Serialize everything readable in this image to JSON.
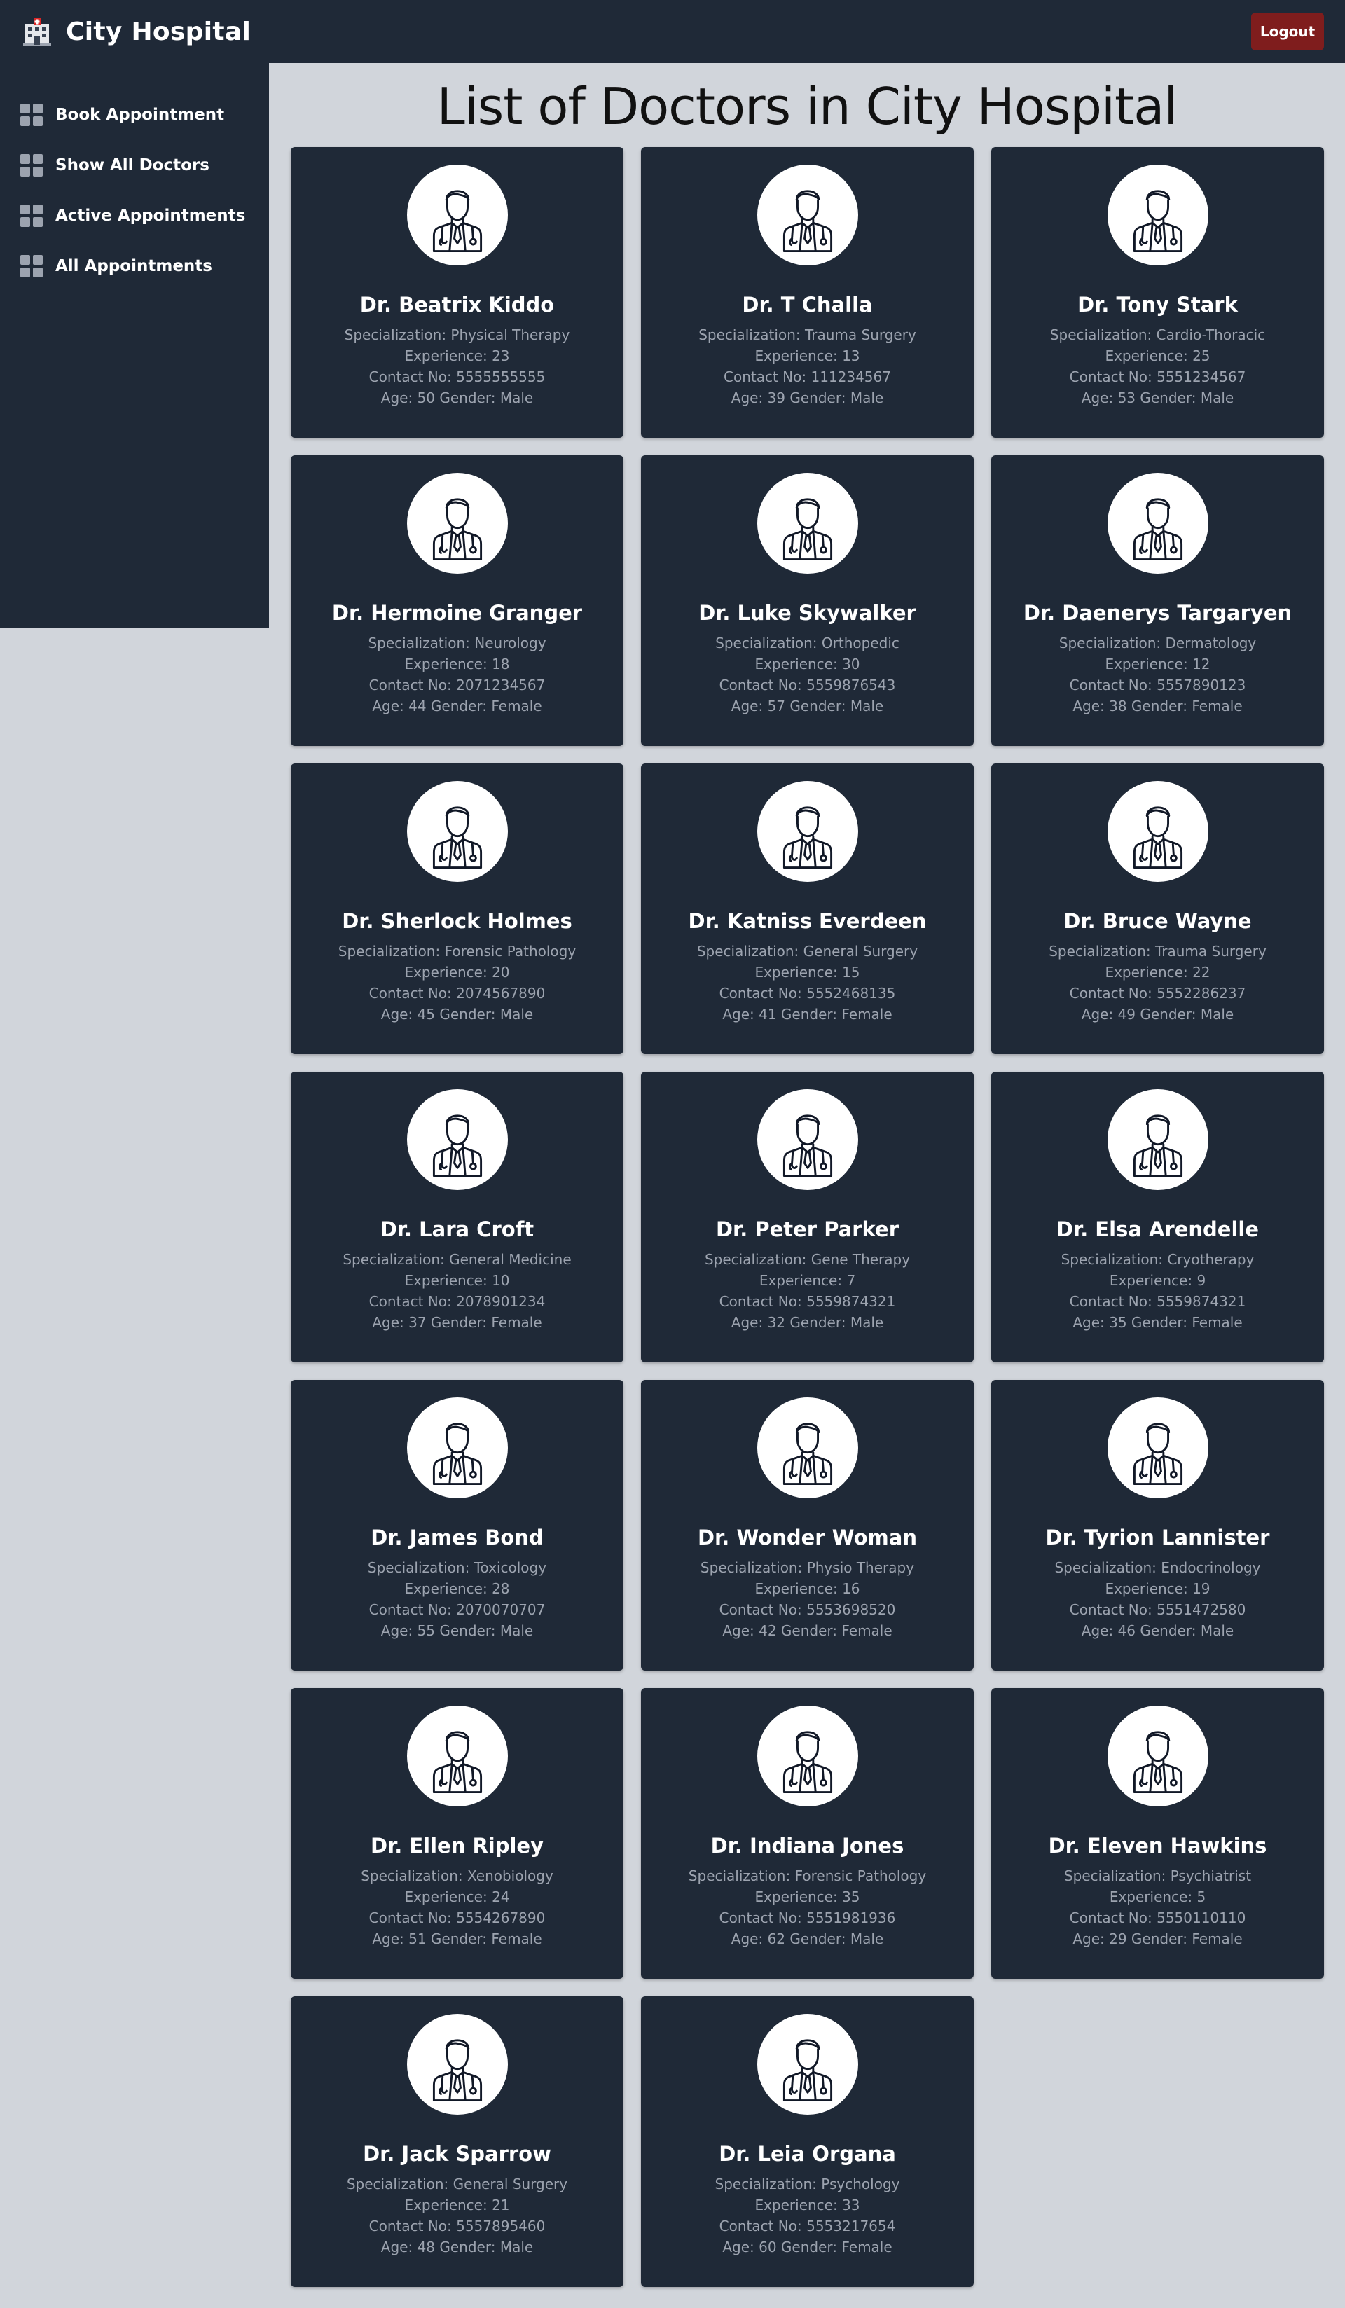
{
  "header": {
    "title": "City Hospital",
    "logo_icon": "hospital-icon",
    "logout_label": "Logout"
  },
  "sidebar": {
    "items": [
      {
        "label": "Book Appointment",
        "icon": "grid-icon"
      },
      {
        "label": "Show All Doctors",
        "icon": "grid-icon"
      },
      {
        "label": "Active Appointments",
        "icon": "grid-icon"
      },
      {
        "label": "All Appointments",
        "icon": "grid-icon"
      }
    ]
  },
  "main": {
    "title": "List of Doctors in City Hospital",
    "doctors": [
      {
        "name": "Dr. Beatrix Kiddo",
        "specialization": "Specialization: Physical Therapy",
        "experience": "Experience: 23",
        "contact": "Contact No: 5555555555",
        "age_gender": "Age: 50 Gender: Male"
      },
      {
        "name": "Dr. T Challa",
        "specialization": "Specialization: Trauma Surgery",
        "experience": "Experience: 13",
        "contact": "Contact No: 111234567",
        "age_gender": "Age: 39 Gender: Male"
      },
      {
        "name": "Dr. Tony Stark",
        "specialization": "Specialization: Cardio-Thoracic",
        "experience": "Experience: 25",
        "contact": "Contact No: 5551234567",
        "age_gender": "Age: 53 Gender: Male"
      },
      {
        "name": "Dr. Hermoine Granger",
        "specialization": "Specialization: Neurology",
        "experience": "Experience: 18",
        "contact": "Contact No: 2071234567",
        "age_gender": "Age: 44 Gender: Female"
      },
      {
        "name": "Dr. Luke Skywalker",
        "specialization": "Specialization: Orthopedic",
        "experience": "Experience: 30",
        "contact": "Contact No: 5559876543",
        "age_gender": "Age: 57 Gender: Male"
      },
      {
        "name": "Dr. Daenerys Targaryen",
        "specialization": "Specialization: Dermatology",
        "experience": "Experience: 12",
        "contact": "Contact No: 5557890123",
        "age_gender": "Age: 38 Gender: Female"
      },
      {
        "name": "Dr. Sherlock Holmes",
        "specialization": "Specialization: Forensic Pathology",
        "experience": "Experience: 20",
        "contact": "Contact No: 2074567890",
        "age_gender": "Age: 45 Gender: Male"
      },
      {
        "name": "Dr. Katniss Everdeen",
        "specialization": "Specialization: General Surgery",
        "experience": "Experience: 15",
        "contact": "Contact No: 5552468135",
        "age_gender": "Age: 41 Gender: Female"
      },
      {
        "name": "Dr. Bruce Wayne",
        "specialization": "Specialization: Trauma Surgery",
        "experience": "Experience: 22",
        "contact": "Contact No: 5552286237",
        "age_gender": "Age: 49 Gender: Male"
      },
      {
        "name": "Dr. Lara Croft",
        "specialization": "Specialization: General Medicine",
        "experience": "Experience: 10",
        "contact": "Contact No: 2078901234",
        "age_gender": "Age: 37 Gender: Female"
      },
      {
        "name": "Dr. Peter Parker",
        "specialization": "Specialization: Gene Therapy",
        "experience": "Experience: 7",
        "contact": "Contact No: 5559874321",
        "age_gender": "Age: 32 Gender: Male"
      },
      {
        "name": "Dr. Elsa Arendelle",
        "specialization": "Specialization: Cryotherapy",
        "experience": "Experience: 9",
        "contact": "Contact No: 5559874321",
        "age_gender": "Age: 35 Gender: Female"
      },
      {
        "name": "Dr. James Bond",
        "specialization": "Specialization: Toxicology",
        "experience": "Experience: 28",
        "contact": "Contact No: 2070070707",
        "age_gender": "Age: 55 Gender: Male"
      },
      {
        "name": "Dr. Wonder Woman",
        "specialization": "Specialization: Physio Therapy",
        "experience": "Experience: 16",
        "contact": "Contact No: 5553698520",
        "age_gender": "Age: 42 Gender: Female"
      },
      {
        "name": "Dr. Tyrion Lannister",
        "specialization": "Specialization: Endocrinology",
        "experience": "Experience: 19",
        "contact": "Contact No: 5551472580",
        "age_gender": "Age: 46 Gender: Male"
      },
      {
        "name": "Dr. Ellen Ripley",
        "specialization": "Specialization: Xenobiology",
        "experience": "Experience: 24",
        "contact": "Contact No: 5554267890",
        "age_gender": "Age: 51 Gender: Female"
      },
      {
        "name": "Dr. Indiana Jones",
        "specialization": "Specialization: Forensic Pathology",
        "experience": "Experience: 35",
        "contact": "Contact No: 5551981936",
        "age_gender": "Age: 62 Gender: Male"
      },
      {
        "name": "Dr. Eleven Hawkins",
        "specialization": "Specialization: Psychiatrist",
        "experience": "Experience: 5",
        "contact": "Contact No: 5550110110",
        "age_gender": "Age: 29 Gender: Female"
      },
      {
        "name": "Dr. Jack Sparrow",
        "specialization": "Specialization: General Surgery",
        "experience": "Experience: 21",
        "contact": "Contact No: 5557895460",
        "age_gender": "Age: 48 Gender: Male"
      },
      {
        "name": "Dr. Leia Organa",
        "specialization": "Specialization: Psychology",
        "experience": "Experience: 33",
        "contact": "Contact No: 5553217654",
        "age_gender": "Age: 60 Gender: Female"
      }
    ],
    "avatar_icon": "doctor-icon"
  },
  "colors": {
    "nav_bg": "#1f2937",
    "page_bg": "#d1d5db",
    "logout_bg": "#7f1d1d",
    "muted_text": "#9ca3af"
  }
}
